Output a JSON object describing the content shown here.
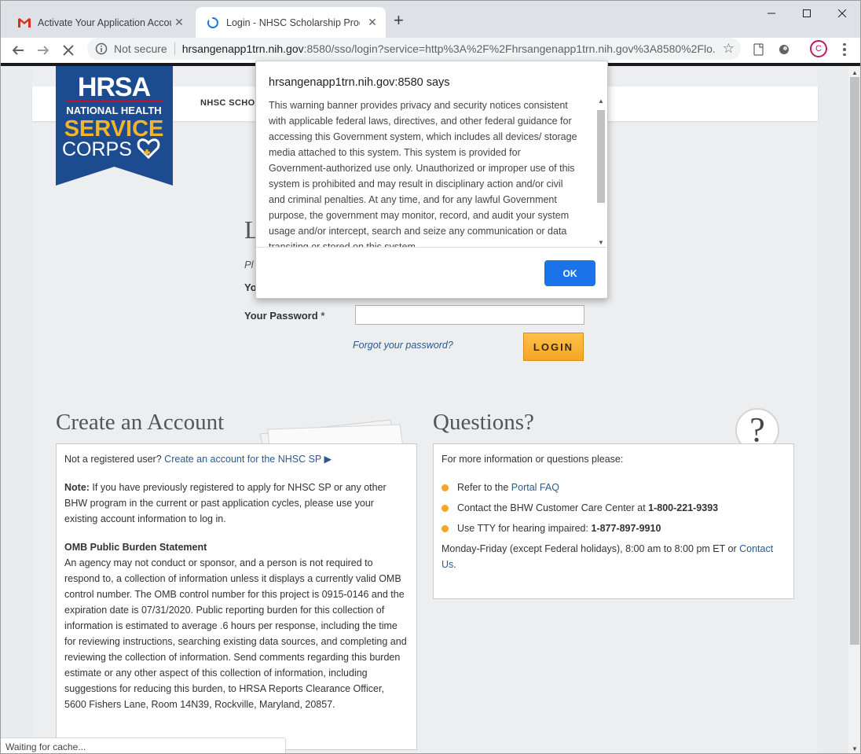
{
  "browser": {
    "tabs": [
      {
        "title": "Activate Your Application Accoun",
        "icon": "gmail-icon",
        "active": false
      },
      {
        "title": "Login - NHSC Scholarship Progra",
        "icon": "loading-spinner-icon",
        "active": true
      }
    ],
    "new_tab": "+",
    "profile_initial": "C",
    "omnibox": {
      "security": "Not secure",
      "host": "hrsangenapp1trn.nih.gov",
      "path": ":8580/sso/login?service=http%3A%2F%2Fhrsangenapp1trn.nih.gov%3A8580%2Flo..."
    }
  },
  "page": {
    "nav_label": "NHSC SCHO",
    "logo": {
      "brand": "HRSA",
      "line1": "NATIONAL HEALTH",
      "line2": "SERVICE",
      "line3": "CORPS"
    },
    "login": {
      "heading_partial": "L",
      "instruction_partial": "Pl",
      "username_label_partial": "Yo",
      "password_label": "Your Password",
      "required_marker": "*",
      "forgot_link": "Forgot your password?",
      "login_button": "LOGIN"
    },
    "create_account": {
      "heading": "Create an Account",
      "intro": "Not a registered user?",
      "create_link": "Create an account for the NHSC SP",
      "create_link_arrow": "▶",
      "note_label": "Note:",
      "note_text": " If you have previously registered to apply for NHSC SP or any other BHW program in the current or past application cycles, please use your existing account information to log in.",
      "omb_heading": "OMB Public Burden Statement",
      "omb_text": "An agency may not conduct or sponsor, and a person is not required to respond to, a collection of information unless it displays a currently valid OMB control number. The OMB control number for this project is 0915-0146 and the expiration date is 07/31/2020. Public reporting burden for this collection of information is estimated to average .6 hours per response, including the time for reviewing instructions, searching existing data sources, and completing and reviewing the collection of information. Send comments regarding this burden estimate or any other aspect of this collection of information, including suggestions for reducing this burden, to HRSA Reports Clearance Officer, 5600 Fishers Lane, Room 14N39, Rockville, Maryland, 20857."
    },
    "questions": {
      "heading": "Questions?",
      "icon_glyph": "?",
      "intro": "For more information or questions please:",
      "items": [
        {
          "prefix": "Refer to the ",
          "link": "Portal FAQ",
          "bold": ""
        },
        {
          "prefix": "Contact the BHW Customer Care Center at ",
          "link": "",
          "bold": "1-800-221-9393"
        },
        {
          "prefix": "Use TTY for hearing impaired: ",
          "link": "",
          "bold": "1-877-897-9910"
        }
      ],
      "hours": "Monday-Friday (except Federal holidays), 8:00 am to 8:00 pm ET or",
      "contact_link": "Contact Us",
      "contact_suffix": "."
    }
  },
  "dialog": {
    "title": "hrsangenapp1trn.nih.gov:8580 says",
    "body": "This warning banner provides privacy and security notices consistent with applicable federal laws, directives, and other federal guidance for accessing this Government system, which includes all devices/ storage media attached to this system. This system is provided for Government-authorized use only. Unauthorized or improper use of this system is prohibited and may result in disciplinary action and/or civil and criminal penalties. At any time, and for any lawful Government purpose, the government may monitor, record, and audit your system usage and/or intercept, search and seize any communication or data transiting or stored on this system.",
    "ok_button": "OK"
  },
  "status_bar": "Waiting for cache...",
  "colors": {
    "login_button": "#f5a623",
    "ok_button": "#1a73e8",
    "link": "#2a5a8f",
    "logo_blue": "#1d4b8f",
    "logo_yellow": "#f2b42d",
    "bullet": "#f4a626"
  }
}
